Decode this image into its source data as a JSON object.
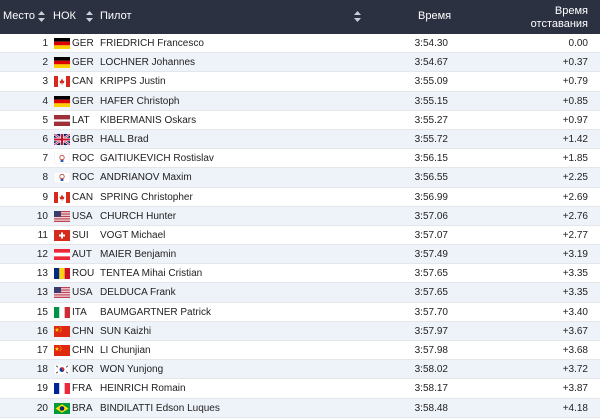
{
  "header": {
    "place": "Место",
    "noc": "НОК",
    "pilot": "Пилот",
    "time": "Время",
    "gap_line1": "Время",
    "gap_line2": "отставания"
  },
  "rows": [
    {
      "place": "1",
      "flag": "GER",
      "noc": "GER",
      "name": "FRIEDRICH Francesco",
      "time": "3:54.30",
      "gap": "0.00"
    },
    {
      "place": "2",
      "flag": "GER",
      "noc": "GER",
      "name": "LOCHNER Johannes",
      "time": "3:54.67",
      "gap": "+0.37"
    },
    {
      "place": "3",
      "flag": "CAN",
      "noc": "CAN",
      "name": "KRIPPS Justin",
      "time": "3:55.09",
      "gap": "+0.79"
    },
    {
      "place": "4",
      "flag": "GER",
      "noc": "GER",
      "name": "HAFER Christoph",
      "time": "3:55.15",
      "gap": "+0.85"
    },
    {
      "place": "5",
      "flag": "LAT",
      "noc": "LAT",
      "name": "KIBERMANIS Oskars",
      "time": "3:55.27",
      "gap": "+0.97"
    },
    {
      "place": "6",
      "flag": "GBR",
      "noc": "GBR",
      "name": "HALL Brad",
      "time": "3:55.72",
      "gap": "+1.42"
    },
    {
      "place": "7",
      "flag": "ROC",
      "noc": "ROC",
      "name": "GAITIUKEVICH Rostislav",
      "time": "3:56.15",
      "gap": "+1.85"
    },
    {
      "place": "8",
      "flag": "ROC",
      "noc": "ROC",
      "name": "ANDRIANOV Maxim",
      "time": "3:56.55",
      "gap": "+2.25"
    },
    {
      "place": "9",
      "flag": "CAN",
      "noc": "CAN",
      "name": "SPRING Christopher",
      "time": "3:56.99",
      "gap": "+2.69"
    },
    {
      "place": "10",
      "flag": "USA",
      "noc": "USA",
      "name": "CHURCH Hunter",
      "time": "3:57.06",
      "gap": "+2.76"
    },
    {
      "place": "11",
      "flag": "SUI",
      "noc": "SUI",
      "name": "VOGT Michael",
      "time": "3:57.07",
      "gap": "+2.77"
    },
    {
      "place": "12",
      "flag": "AUT",
      "noc": "AUT",
      "name": "MAIER Benjamin",
      "time": "3:57.49",
      "gap": "+3.19"
    },
    {
      "place": "13",
      "flag": "ROU",
      "noc": "ROU",
      "name": "TENTEA Mihai Cristian",
      "time": "3:57.65",
      "gap": "+3.35"
    },
    {
      "place": "13",
      "flag": "USA",
      "noc": "USA",
      "name": "DELDUCA Frank",
      "time": "3:57.65",
      "gap": "+3.35"
    },
    {
      "place": "15",
      "flag": "ITA",
      "noc": "ITA",
      "name": "BAUMGARTNER Patrick",
      "time": "3:57.70",
      "gap": "+3.40"
    },
    {
      "place": "16",
      "flag": "CHN",
      "noc": "CHN",
      "name": "SUN Kaizhi",
      "time": "3:57.97",
      "gap": "+3.67"
    },
    {
      "place": "17",
      "flag": "CHN",
      "noc": "CHN",
      "name": "LI Chunjian",
      "time": "3:57.98",
      "gap": "+3.68"
    },
    {
      "place": "18",
      "flag": "KOR",
      "noc": "KOR",
      "name": "WON Yunjong",
      "time": "3:58.02",
      "gap": "+3.72"
    },
    {
      "place": "19",
      "flag": "FRA",
      "noc": "FRA",
      "name": "HEINRICH Romain",
      "time": "3:58.17",
      "gap": "+3.87"
    },
    {
      "place": "20",
      "flag": "BRA",
      "noc": "BRA",
      "name": "BINDILATTI Edson Luques",
      "time": "3:58.48",
      "gap": "+4.18"
    }
  ]
}
